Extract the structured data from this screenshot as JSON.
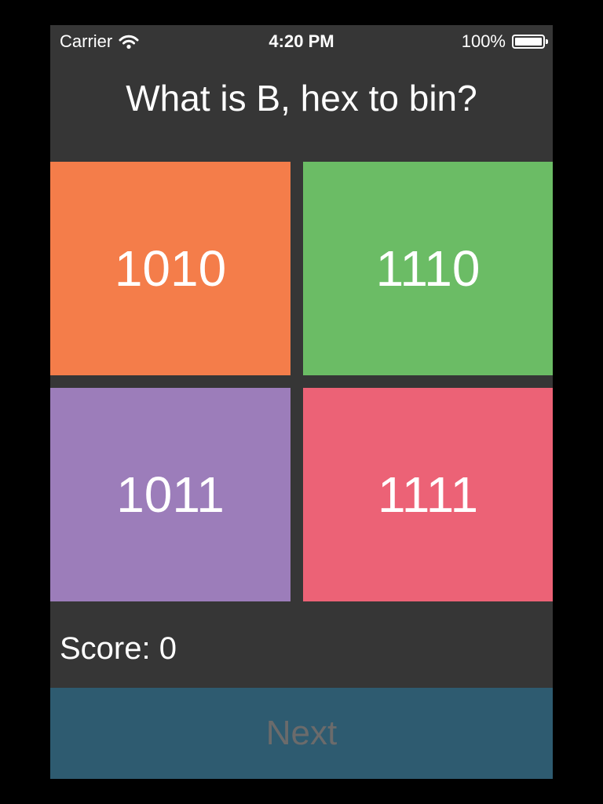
{
  "status_bar": {
    "carrier": "Carrier",
    "time": "4:20 PM",
    "battery": "100%",
    "battery_level": 1.0,
    "icons": [
      "wifi-icon",
      "battery-icon"
    ]
  },
  "question": "What is B, hex to bin?",
  "answers": [
    {
      "label": "1010",
      "color": "#F47D4A"
    },
    {
      "label": "1110",
      "color": "#6BBC65"
    },
    {
      "label": "1011",
      "color": "#9C7DBA"
    },
    {
      "label": "1111",
      "color": "#EC6276"
    }
  ],
  "score": {
    "text": "Score: 0"
  },
  "next": {
    "label": "Next",
    "background": "#2E5B70",
    "text_color": "#6B6B6B"
  },
  "colors": {
    "background": "#363636",
    "frame": "#000000",
    "text": "#FFFFFF"
  }
}
